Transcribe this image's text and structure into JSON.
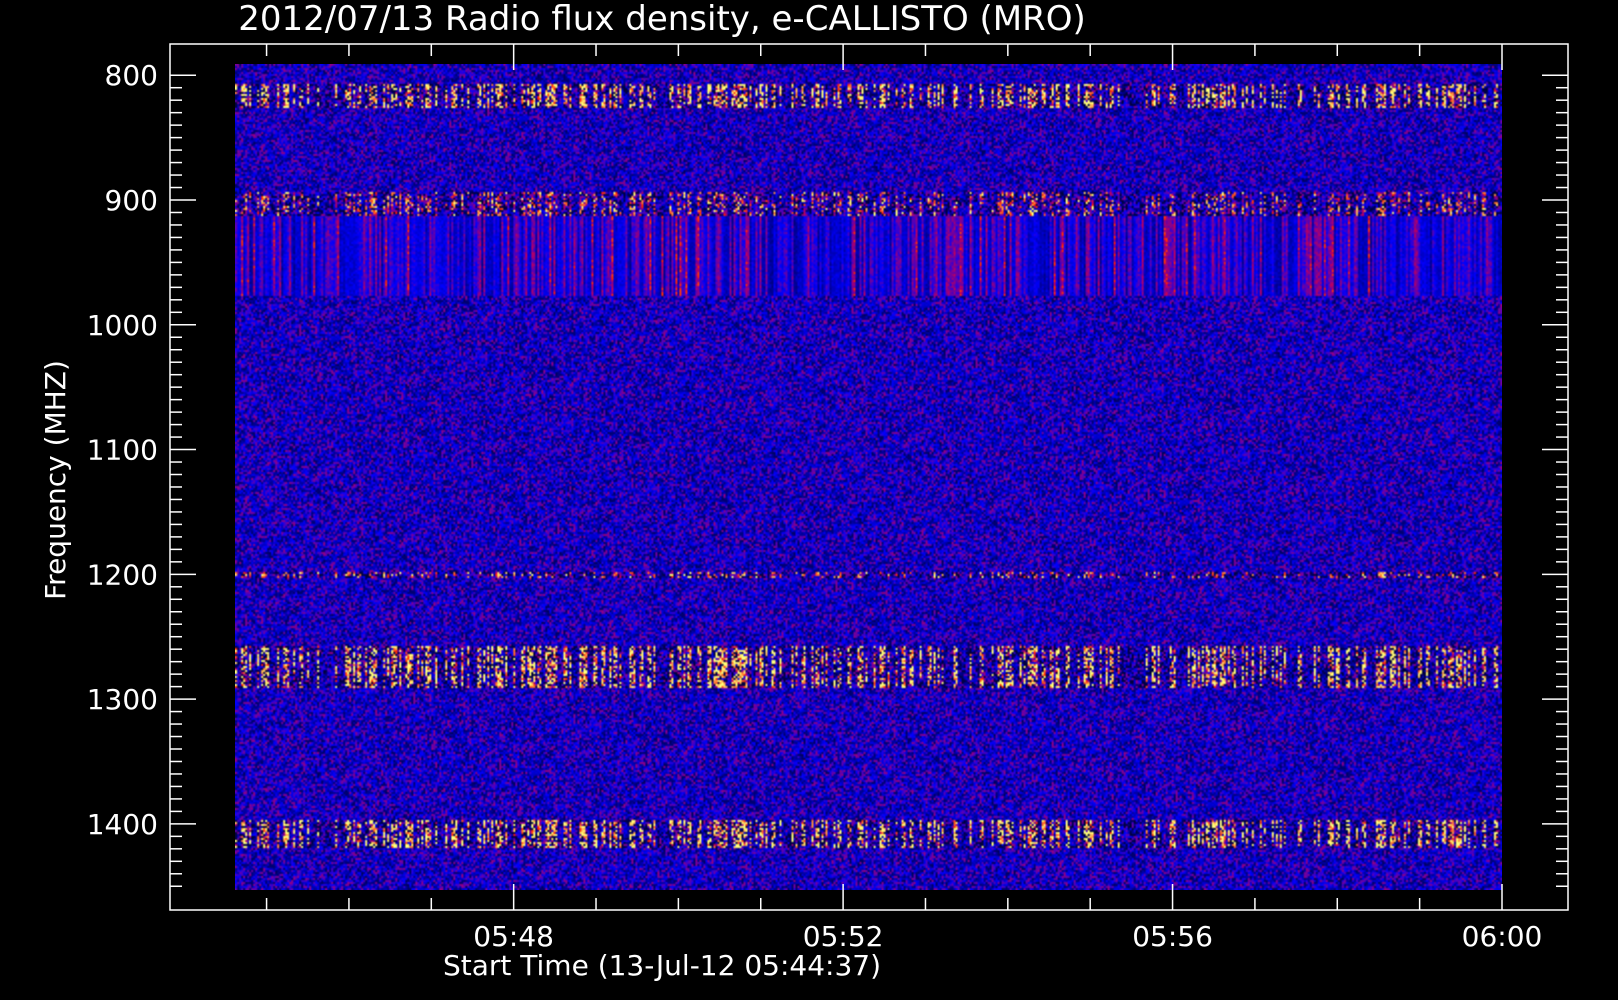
{
  "chart_data": {
    "type": "heatmap",
    "title": "2012/07/13  Radio flux density, e-CALLISTO (MRO)",
    "xlabel": "Start Time (13-Jul-12 05:44:37)",
    "ylabel": "Frequency (MHZ)",
    "x_ticks": [
      "05:48",
      "05:52",
      "05:56",
      "06:00"
    ],
    "y_ticks": [
      800,
      900,
      1000,
      1100,
      1200,
      1300,
      1400
    ],
    "xlim": [
      "05:44:37",
      "06:00:00"
    ],
    "ylim": [
      1453,
      791
    ],
    "y_inverted": true,
    "colormap": {
      "low": "#000000",
      "mid": "#1414ff",
      "high": "#ffff66"
    },
    "features": [
      {
        "name": "emission band",
        "freq_range": [
          806,
          826
        ],
        "intensity": "high"
      },
      {
        "name": "emission band",
        "freq_range": [
          893,
          913
        ],
        "intensity": "medium"
      },
      {
        "name": "interference band",
        "freq_range": [
          913,
          977
        ],
        "intensity": "striped"
      },
      {
        "name": "emission line",
        "freq_range": [
          1199,
          1203
        ],
        "intensity": "medium"
      },
      {
        "name": "emission band",
        "freq_range": [
          1258,
          1292
        ],
        "intensity": "high"
      },
      {
        "name": "emission band",
        "freq_range": [
          1398,
          1420
        ],
        "intensity": "high"
      }
    ]
  }
}
